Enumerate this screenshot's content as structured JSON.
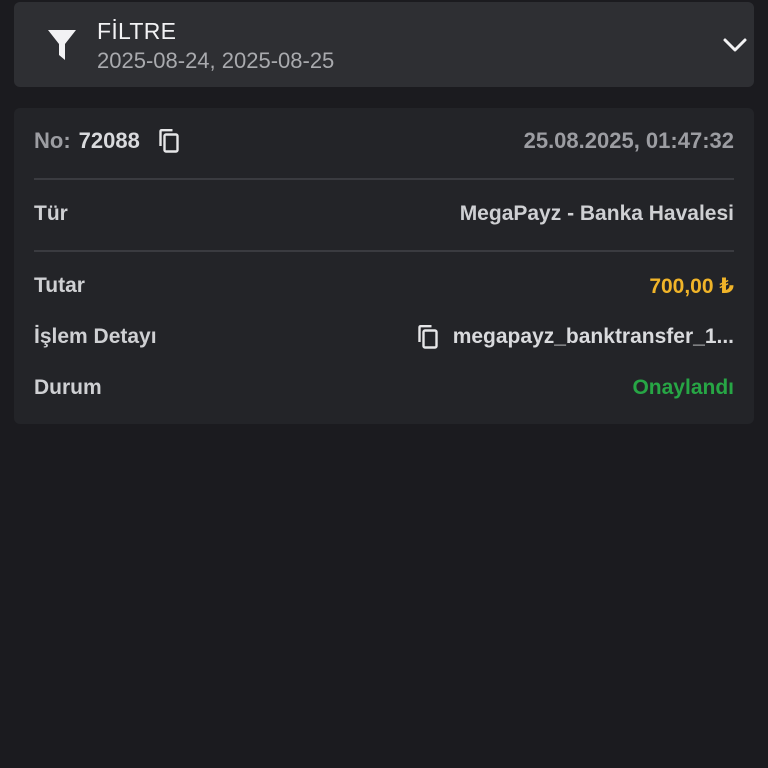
{
  "filter": {
    "title": "FİLTRE",
    "dates": "2025-08-24, 2025-08-25",
    "icons": {
      "filter": "filter-icon",
      "expand": "chevron-down-icon"
    }
  },
  "transaction": {
    "no_label": "No:",
    "no_value": "72088",
    "datetime": "25.08.2025, 01:47:32",
    "type_label": "Tür",
    "type_value": "MegaPayz - Banka Havalesi",
    "amount_label": "Tutar",
    "amount_value": "700,00 ₺",
    "detail_label": "İşlem Detayı",
    "detail_value": "megapayz_banktransfer_1...",
    "status_label": "Durum",
    "status_value": "Onaylandı",
    "icons": {
      "copy": "copy-icon"
    }
  },
  "colors": {
    "background": "#1b1b1f",
    "filter_bar": "#2e2f33",
    "card": "#232428",
    "amount": "#f0b429",
    "status": "#27a645"
  }
}
